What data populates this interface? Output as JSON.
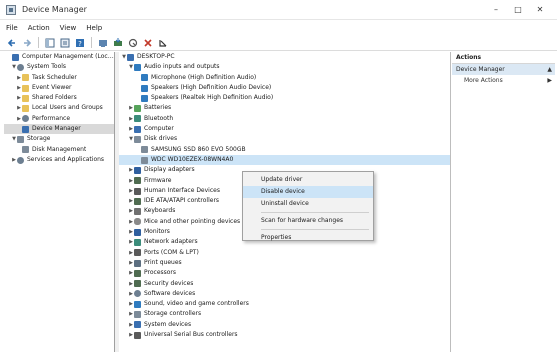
{
  "window": {
    "title": "Device Manager",
    "minimize": "–",
    "maximize": "□",
    "close": "✕"
  },
  "menu": [
    "File",
    "Action",
    "View",
    "Help"
  ],
  "toolbar_icons": [
    "back-icon",
    "forward-icon",
    "show-hide-tree-icon",
    "properties-icon",
    "help-icon",
    "scan-hardware-icon",
    "update-driver-icon",
    "disable-device-icon",
    "uninstall-icon"
  ],
  "left_tree": [
    {
      "label": "Computer Management (Local)",
      "indent": 0,
      "expander": "",
      "icon": "computer"
    },
    {
      "label": "System Tools",
      "indent": 1,
      "expander": "▼",
      "icon": "gear"
    },
    {
      "label": "Task Scheduler",
      "indent": 2,
      "expander": "▶",
      "icon": "folder"
    },
    {
      "label": "Event Viewer",
      "indent": 2,
      "expander": "▶",
      "icon": "folder"
    },
    {
      "label": "Shared Folders",
      "indent": 2,
      "expander": "▶",
      "icon": "folder"
    },
    {
      "label": "Local Users and Groups",
      "indent": 2,
      "expander": "▶",
      "icon": "folder"
    },
    {
      "label": "Performance",
      "indent": 2,
      "expander": "▶",
      "icon": "gear"
    },
    {
      "label": "Device Manager",
      "indent": 2,
      "expander": "",
      "icon": "computer",
      "selected": true
    },
    {
      "label": "Storage",
      "indent": 1,
      "expander": "▼",
      "icon": "disk"
    },
    {
      "label": "Disk Management",
      "indent": 2,
      "expander": "",
      "icon": "disk"
    },
    {
      "label": "Services and Applications",
      "indent": 1,
      "expander": "▶",
      "icon": "gear"
    }
  ],
  "device_tree": [
    {
      "label": "DESKTOP-PC",
      "indent": 0,
      "expander": "▼",
      "icon": "computer"
    },
    {
      "label": "Audio inputs and outputs",
      "indent": 1,
      "expander": "▼",
      "icon": "sound"
    },
    {
      "label": "Microphone (High Definition Audio)",
      "indent": 2,
      "expander": "",
      "icon": "sound"
    },
    {
      "label": "Speakers (High Definition Audio Device)",
      "indent": 2,
      "expander": "",
      "icon": "sound"
    },
    {
      "label": "Speakers (Realtek High Definition Audio)",
      "indent": 2,
      "expander": "",
      "icon": "sound"
    },
    {
      "label": "Batteries",
      "indent": 1,
      "expander": "▶",
      "icon": "battery"
    },
    {
      "label": "Bluetooth",
      "indent": 1,
      "expander": "▶",
      "icon": "net"
    },
    {
      "label": "Computer",
      "indent": 1,
      "expander": "▶",
      "icon": "computer"
    },
    {
      "label": "Disk drives",
      "indent": 1,
      "expander": "▼",
      "icon": "disk"
    },
    {
      "label": "SAMSUNG SSD 860 EVO 500GB",
      "indent": 2,
      "expander": "",
      "icon": "disk"
    },
    {
      "label": "WDC WD10EZEX-08WN4A0",
      "indent": 2,
      "expander": "",
      "icon": "disk",
      "selected": true
    },
    {
      "label": "Display adapters",
      "indent": 1,
      "expander": "▶",
      "icon": "monitor"
    },
    {
      "label": "Firmware",
      "indent": 1,
      "expander": "▶",
      "icon": "chip"
    },
    {
      "label": "Human Interface Devices",
      "indent": 1,
      "expander": "▶",
      "icon": "usb"
    },
    {
      "label": "IDE ATA/ATAPI controllers",
      "indent": 1,
      "expander": "▶",
      "icon": "chip"
    },
    {
      "label": "Keyboards",
      "indent": 1,
      "expander": "▶",
      "icon": "keyboard"
    },
    {
      "label": "Mice and other pointing devices",
      "indent": 1,
      "expander": "▶",
      "icon": "mouse"
    },
    {
      "label": "Monitors",
      "indent": 1,
      "expander": "▶",
      "icon": "monitor"
    },
    {
      "label": "Network adapters",
      "indent": 1,
      "expander": "▶",
      "icon": "net"
    },
    {
      "label": "Ports (COM & LPT)",
      "indent": 1,
      "expander": "▶",
      "icon": "usb"
    },
    {
      "label": "Print queues",
      "indent": 1,
      "expander": "▶",
      "icon": "printer"
    },
    {
      "label": "Processors",
      "indent": 1,
      "expander": "▶",
      "icon": "chip"
    },
    {
      "label": "Security devices",
      "indent": 1,
      "expander": "▶",
      "icon": "chip"
    },
    {
      "label": "Software devices",
      "indent": 1,
      "expander": "▶",
      "icon": "gear"
    },
    {
      "label": "Sound, video and game controllers",
      "indent": 1,
      "expander": "▶",
      "icon": "sound"
    },
    {
      "label": "Storage controllers",
      "indent": 1,
      "expander": "▶",
      "icon": "disk"
    },
    {
      "label": "System devices",
      "indent": 1,
      "expander": "▶",
      "icon": "computer"
    },
    {
      "label": "Universal Serial Bus controllers",
      "indent": 1,
      "expander": "▶",
      "icon": "usb"
    }
  ],
  "context_menu": {
    "items": [
      {
        "label": "Update driver",
        "highlight": false
      },
      {
        "label": "Disable device",
        "highlight": true
      },
      {
        "label": "Uninstall device",
        "highlight": false
      },
      {
        "sep": true
      },
      {
        "label": "Scan for hardware changes",
        "highlight": false
      },
      {
        "sep": true
      },
      {
        "label": "Properties",
        "highlight": false
      }
    ]
  },
  "actions_pane": {
    "header": "Actions",
    "section": "Device Manager",
    "section_arrow": "▲",
    "items": [
      {
        "label": "More Actions",
        "arrow": "▶"
      }
    ]
  }
}
